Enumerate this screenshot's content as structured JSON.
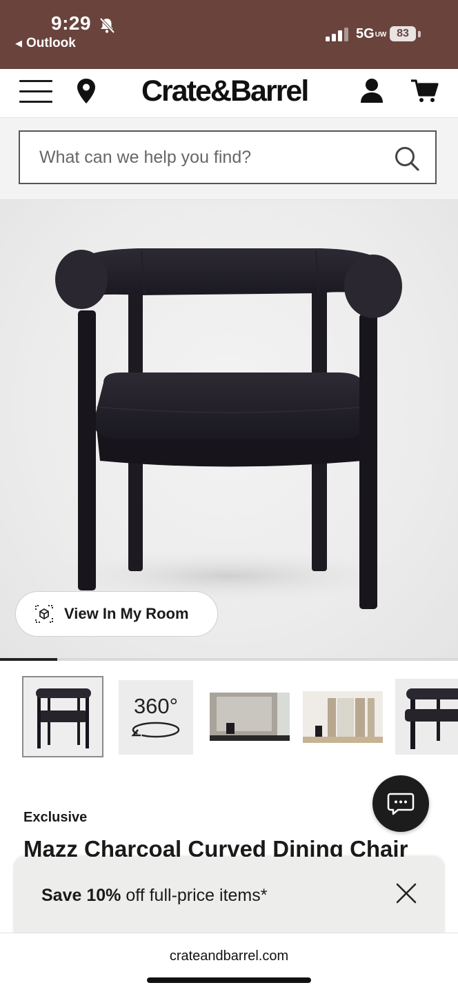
{
  "status_bar": {
    "time": "9:29",
    "back_app": "Outlook",
    "network": "5G",
    "network_suffix": "UW",
    "battery": "83"
  },
  "header": {
    "brand": "Crate&Barrel",
    "icons": [
      "hamburger-menu-icon",
      "location-pin-icon",
      "account-icon",
      "cart-icon"
    ]
  },
  "search": {
    "placeholder": "What can we help you find?"
  },
  "hero": {
    "view_in_room_label": "View In My Room",
    "carousel_progress": 0.125
  },
  "thumbnails": {
    "items": [
      "chair-front",
      "360-view",
      "room-scene-wide",
      "room-scene-curtains",
      "chair-angle"
    ],
    "spin_label": "360°",
    "selected_index": 0
  },
  "product": {
    "badge": "Exclusive",
    "title": "Mazz Charcoal Curved Dining Chair"
  },
  "promo": {
    "bold_text": "Save 10%",
    "rest_text": " off full-price items*"
  },
  "browser": {
    "url": "crateandbarrel.com"
  },
  "colors": {
    "status_bar_bg": "#6a433d",
    "chair": "#1f1d24",
    "chat_button": "#1c1c1c"
  }
}
